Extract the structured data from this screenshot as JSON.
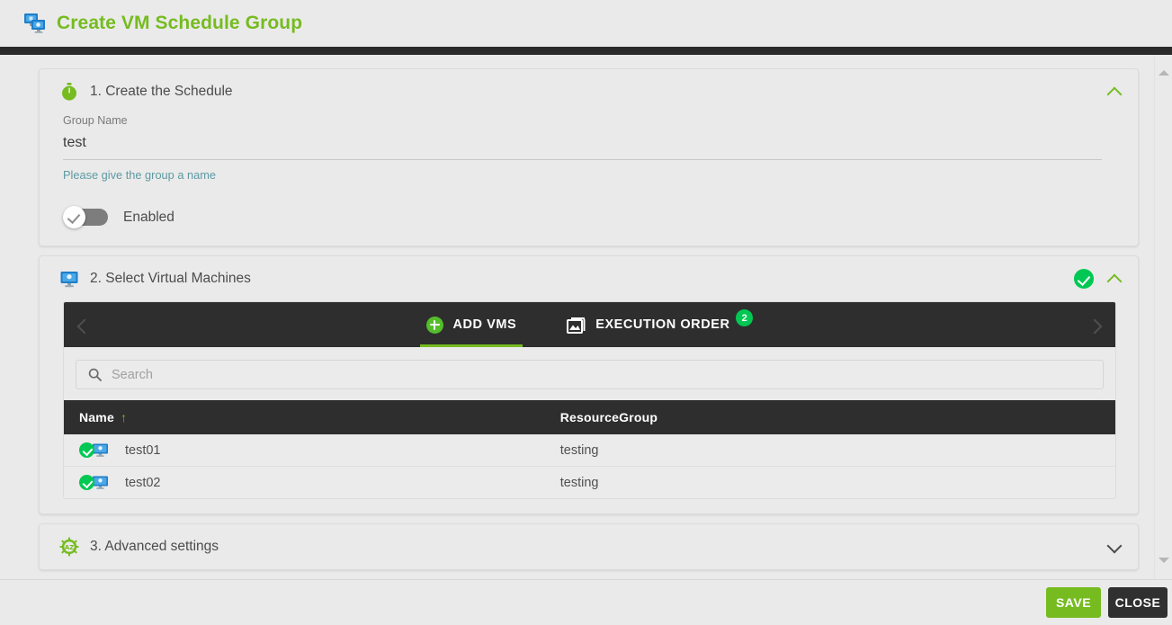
{
  "header": {
    "title": "Create VM Schedule Group",
    "icon": "vm-group-icon",
    "title_color": "#76bc21"
  },
  "sections": [
    {
      "id": "create-schedule",
      "title": "1. Create the Schedule",
      "icon": "stopwatch-icon",
      "expanded": true,
      "chevron": "chevron-up",
      "field": {
        "label": "Group Name",
        "value": "test",
        "placeholder": "",
        "hint": "Please give the group a name"
      },
      "toggle": {
        "label": "Enabled",
        "state": "on"
      }
    },
    {
      "id": "select-vms",
      "title": "2. Select Virtual Machines",
      "icon": "monitor-icon",
      "expanded": true,
      "chevron": "chevron-up",
      "status": "complete",
      "tabs": {
        "prev_arrow": "chevron-left-icon",
        "next_arrow": "chevron-right-icon",
        "items": [
          {
            "label": "ADD VMS",
            "icon": "plus-circle-icon",
            "active": true,
            "badge": ""
          },
          {
            "label": "EXECUTION ORDER",
            "icon": "collections-icon",
            "active": false,
            "badge": "2"
          }
        ]
      },
      "search": {
        "placeholder": "Search",
        "value": "",
        "icon": "search-icon"
      },
      "table": {
        "columns": [
          {
            "key": "name",
            "label": "Name",
            "sorted": "asc",
            "sort_glyph": "↑"
          },
          {
            "key": "resourcegroup",
            "label": "ResourceGroup",
            "sorted": "",
            "sort_glyph": ""
          }
        ],
        "rows": [
          {
            "name": "test01",
            "resourcegroup": "testing",
            "selected": true
          },
          {
            "name": "test02",
            "resourcegroup": "testing",
            "selected": true
          }
        ]
      }
    },
    {
      "id": "advanced-settings",
      "title": "3. Advanced settings",
      "icon": "gear-az-icon",
      "expanded": false,
      "chevron": "chevron-down"
    }
  ],
  "footer": {
    "save_label": "SAVE",
    "close_label": "CLOSE",
    "save_color": "#76bc21",
    "close_color": "#303030"
  },
  "scrollbar": {
    "up_arrow": "scroll-up-arrow",
    "down_arrow": "scroll-down-arrow"
  }
}
